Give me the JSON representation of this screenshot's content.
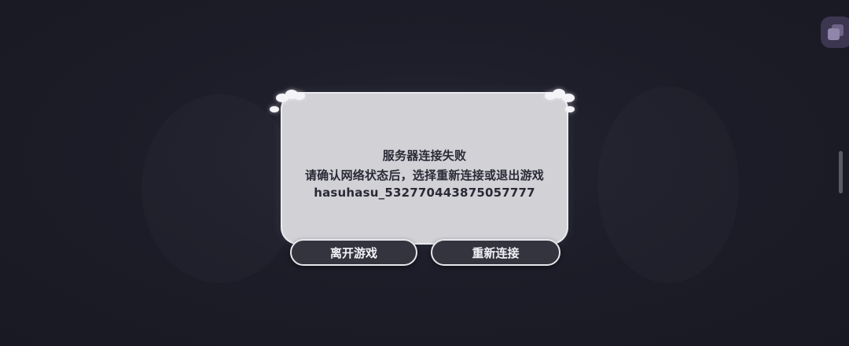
{
  "dialog": {
    "title": "服务器连接失败",
    "message": "请确认网络状态后，选择重新连接或退出游戏",
    "error_code": "hasuhasu_532770443875057777"
  },
  "buttons": {
    "leave_label": "离开游戏",
    "reconnect_label": "重新连接"
  },
  "corner_button": {
    "icon": "overlapping-squares-icon"
  },
  "colors": {
    "background": "#1b1b27",
    "dialog_panel": "#d1d1d6",
    "button_fill": "#34343f",
    "button_text": "#f2f2f6",
    "dialog_text": "#2a2a36",
    "corner_accent": "#3c3650"
  }
}
